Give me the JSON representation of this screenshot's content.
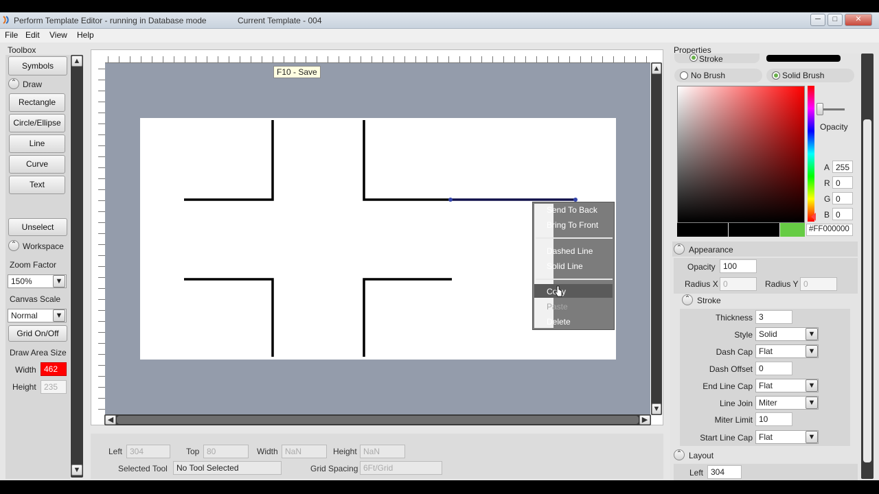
{
  "window": {
    "title": "Perform Template Editor - running in Database mode",
    "template": "Current Template - 004",
    "min_glyph": "─",
    "max_glyph": "□",
    "close_glyph": "✕"
  },
  "menu": [
    "File",
    "Edit",
    "View",
    "Help"
  ],
  "toolbox": {
    "title": "Toolbox",
    "symbols_label": "Symbols",
    "draw_label": "Draw",
    "tools": [
      "Rectangle",
      "Circle/Ellipse",
      "Line",
      "Curve",
      "Text"
    ],
    "unselect_label": "Unselect",
    "workspace_label": "Workspace",
    "zoom_label": "Zoom Factor",
    "zoom_value": "150%",
    "canvas_scale_label": "Canvas Scale",
    "canvas_scale_value": "Normal",
    "grid_button": "Grid On/Off",
    "draw_area_label": "Draw Area Size",
    "width_label": "Width",
    "width_value": "462",
    "height_label": "Height",
    "height_value": "235"
  },
  "canvas": {
    "tooltip": "F10 - Save"
  },
  "context_menu": {
    "items": [
      {
        "label": "Send To Back",
        "enabled": true
      },
      {
        "label": "Bring To Front",
        "enabled": true
      },
      {
        "label": "Dashed Line",
        "enabled": true
      },
      {
        "label": "Solid Line",
        "enabled": true
      },
      {
        "label": "Copy",
        "enabled": true
      },
      {
        "label": "Paste",
        "enabled": false
      },
      {
        "label": "Delete",
        "enabled": true
      }
    ]
  },
  "status": {
    "left_label": "Left",
    "left_value": "304",
    "top_label": "Top",
    "top_value": "80",
    "width_label": "Width",
    "width_value": "NaN",
    "height_label": "Height",
    "height_value": "NaN",
    "selected_tool_label": "Selected Tool",
    "selected_tool_value": "No Tool Selected",
    "grid_spacing_label": "Grid Spacing",
    "grid_spacing_value": "6Ft/Grid"
  },
  "properties": {
    "title": "Properties",
    "stroke_label": "Stroke",
    "no_brush_label": "No Brush",
    "solid_brush_label": "Solid Brush",
    "opacity_label": "Opacity",
    "a_label": "A",
    "a_value": "255",
    "r_label": "R",
    "r_value": "0",
    "g_label": "G",
    "g_value": "0",
    "b_label": "B",
    "b_value": "0",
    "hex_value": "#FF000000",
    "appearance_label": "Appearance",
    "appearance_opacity_label": "Opacity",
    "appearance_opacity_value": "100",
    "radius_x_label": "Radius X",
    "radius_x_value": "0",
    "radius_y_label": "Radius Y",
    "radius_y_value": "0",
    "stroke_section_label": "Stroke",
    "thickness_label": "Thickness",
    "thickness_value": "3",
    "style_label": "Style",
    "style_value": "Solid",
    "dash_cap_label": "Dash Cap",
    "dash_cap_value": "Flat",
    "dash_offset_label": "Dash Offset",
    "dash_offset_value": "0",
    "end_line_cap_label": "End Line Cap",
    "end_line_cap_value": "Flat",
    "line_join_label": "Line Join",
    "line_join_value": "Miter",
    "miter_limit_label": "Miter Limit",
    "miter_limit_value": "10",
    "start_line_cap_label": "Start Line Cap",
    "start_line_cap_value": "Flat",
    "layout_label": "Layout",
    "layout_left_label": "Left",
    "layout_left_value": "304"
  },
  "colors": {
    "accent_green": "#66cc44",
    "width_highlight": "#ff0000",
    "canvas_bg": "#949cab"
  }
}
